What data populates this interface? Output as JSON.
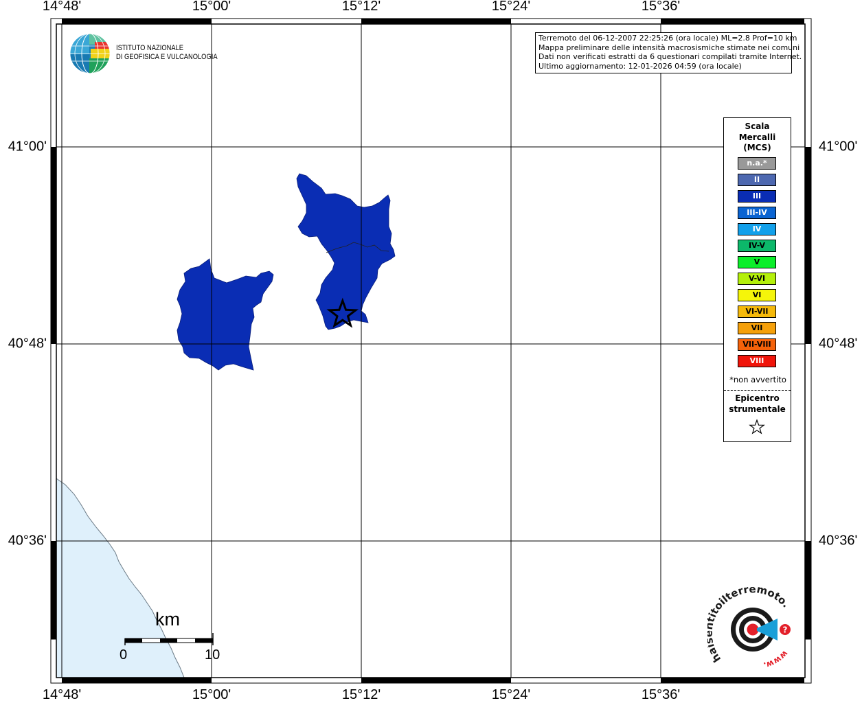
{
  "map": {
    "lon_labels": [
      "14°48'",
      "15°00'",
      "15°12'",
      "15°24'",
      "15°36'"
    ],
    "lat_labels": [
      "41°00'",
      "40°48'",
      "40°36'"
    ],
    "lon_ticks_deg": [
      14.8,
      15.0,
      15.2,
      15.4,
      15.6
    ],
    "lat_ticks_deg": [
      41.0,
      40.8,
      40.6
    ],
    "bounds": {
      "lon_min": 14.8,
      "lon_max": 15.8,
      "lat_min": 40.5,
      "lat_max": 41.1
    },
    "epicenter": {
      "lon": 15.175,
      "lat": 40.83
    },
    "felt_color": "#0a2db4",
    "sea_color": "#dff0fb",
    "grid_color": "#000000"
  },
  "info": {
    "line1": "Terremoto del 06-12-2007 22:25:26 (ora locale) ML=2.8 Prof=10 km",
    "line2": "Mappa preliminare delle intensità macrosismiche stimate nei comuni",
    "line3": "Dati non verificati estratti da 6 questionari compilati tramite Internet.",
    "line4": "Ultimo aggiornamento: 12-01-2026 04:59 (ora locale)"
  },
  "legend": {
    "title_line1": "Scala",
    "title_line2": "Mercalli",
    "title_line3": "(MCS)",
    "items": [
      {
        "label": "n.a.*",
        "color": "#999999"
      },
      {
        "label": "II",
        "color": "#4d68b0"
      },
      {
        "label": "III",
        "color": "#0a2db4"
      },
      {
        "label": "III-IV",
        "color": "#0a64d2"
      },
      {
        "label": "IV",
        "color": "#12a0ea"
      },
      {
        "label": "IV-V",
        "color": "#0cb86a"
      },
      {
        "label": "V",
        "color": "#0bef2a"
      },
      {
        "label": "V-VI",
        "color": "#b4f00a"
      },
      {
        "label": "VI",
        "color": "#f5f50a"
      },
      {
        "label": "VI-VII",
        "color": "#f5b90a"
      },
      {
        "label": "VII",
        "color": "#f5a00a"
      },
      {
        "label": "VII-VIII",
        "color": "#f5620a"
      },
      {
        "label": "VIII",
        "color": "#f0140a"
      }
    ],
    "note": "*non avvertito",
    "epi_line1": "Epicentro",
    "epi_line2": "strumentale"
  },
  "ingv": {
    "line1": "ISTITUTO NAZIONALE",
    "line2": "DI GEOFISICA E VULCANOLOGIA"
  },
  "scalebar": {
    "unit": "km",
    "start": "0",
    "end": "10"
  },
  "hst": {
    "text": "haisentitoilterremoto.it",
    "www": "www."
  }
}
